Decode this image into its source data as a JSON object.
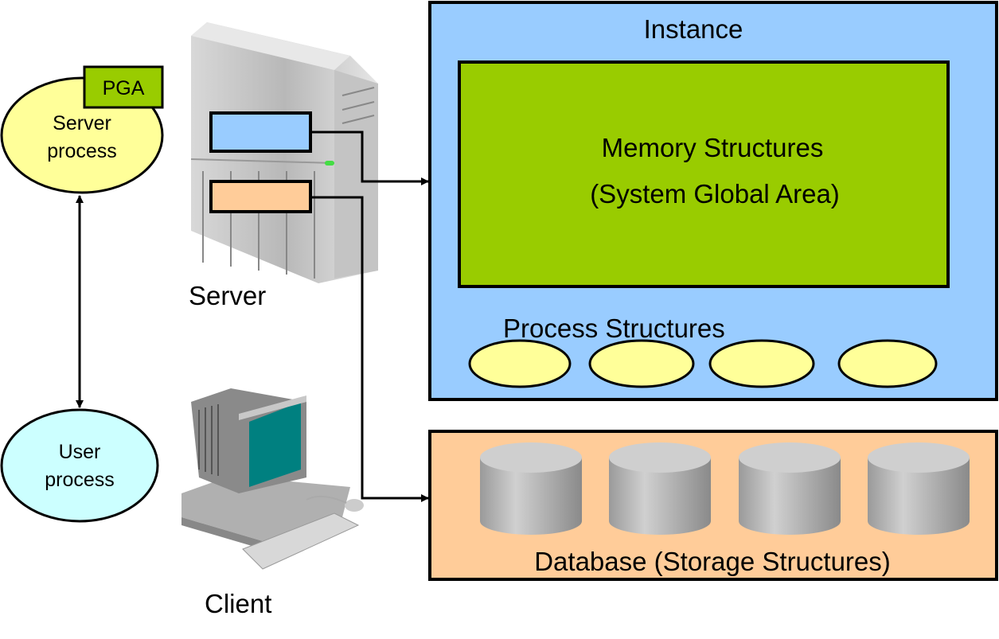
{
  "colors": {
    "instance": "#99CCFF",
    "sga": "#99CC00",
    "pga": "#99CC00",
    "server_process": "#FFFF99",
    "user_process": "#CCFFFF",
    "database": "#FFCC99",
    "background_process": "#FFFF99",
    "monitor_screen": "#008080"
  },
  "server_process": {
    "line1": "Server",
    "line2": "process",
    "pga": "PGA"
  },
  "user_process": {
    "line1": "User",
    "line2": "process"
  },
  "server": {
    "label": "Server",
    "icon": "server-tower-icon"
  },
  "client": {
    "label": "Client",
    "icon": "desktop-computer-icon"
  },
  "instance": {
    "title": "Instance",
    "memory": {
      "line1": "Memory Structures",
      "line2": "(System Global Area)"
    },
    "process_label": "Process Structures"
  },
  "database": {
    "label": "Database (Storage Structures)"
  }
}
